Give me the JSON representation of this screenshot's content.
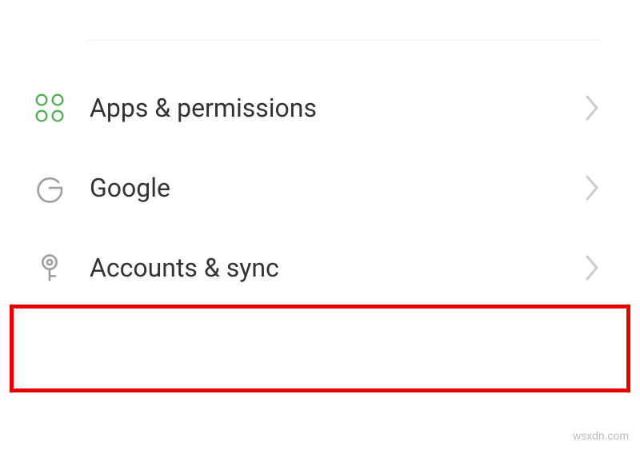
{
  "settings": {
    "items": [
      {
        "label": "Apps & permissions"
      },
      {
        "label": "Google"
      },
      {
        "label": "Accounts & sync"
      }
    ]
  },
  "colors": {
    "apps_icon": "#4cb050",
    "text": "#333333",
    "chevron": "#cccccc",
    "icon_gray": "#9e9e9e",
    "highlight": "#e60000"
  },
  "watermark": "wsxdn.com"
}
